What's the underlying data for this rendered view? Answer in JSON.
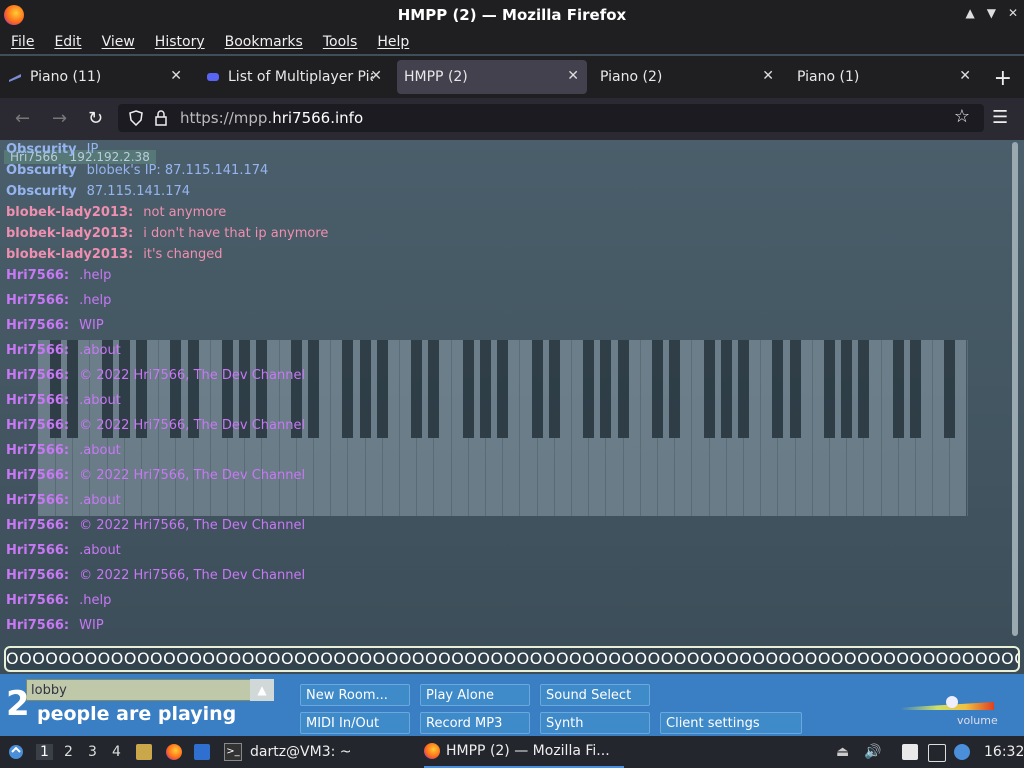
{
  "window": {
    "title": "HMPP (2) — Mozilla Firefox",
    "controls": [
      "▲",
      "▼",
      "✕"
    ]
  },
  "menu": [
    "File",
    "Edit",
    "View",
    "History",
    "Bookmarks",
    "Tools",
    "Help"
  ],
  "tabs": [
    {
      "label": "Piano (11)",
      "active": false
    },
    {
      "label": "List of Multiplayer Pia",
      "active": false
    },
    {
      "label": "HMPP (2)",
      "active": true
    },
    {
      "label": "Piano (2)",
      "active": false
    },
    {
      "label": "Piano (1)",
      "active": false
    }
  ],
  "nav": {
    "url_prefix": "https://mpp.",
    "url_domain": "hri7566.info"
  },
  "overlay_ids": [
    "Hri7566",
    "192.192.2.38"
  ],
  "chat": [
    {
      "name": "Obscurity",
      "text": "IP",
      "color": "blue"
    },
    {
      "name": "Obscurity",
      "text": "blobek's IP: 87.115.141.174",
      "color": "blue"
    },
    {
      "name": "Obscurity",
      "text": "87.115.141.174",
      "color": "blue"
    },
    {
      "name": "blobek-lady2013:",
      "text": "not anymore",
      "color": "pink"
    },
    {
      "name": "blobek-lady2013:",
      "text": "i don't have that ip anymore",
      "color": "pink"
    },
    {
      "name": "blobek-lady2013:",
      "text": "it's changed",
      "color": "pink"
    },
    {
      "name": "Hri7566:",
      "text": ".help",
      "color": "purple"
    },
    {
      "name": "Hri7566:",
      "text": ".help",
      "color": "purple"
    },
    {
      "name": "Hri7566:",
      "text": "WIP",
      "color": "purple"
    },
    {
      "name": "Hri7566:",
      "text": ".about",
      "color": "purple"
    },
    {
      "name": "Hri7566:",
      "text": "© 2022 Hri7566, The Dev Channel",
      "color": "purple"
    },
    {
      "name": "Hri7566:",
      "text": ".about",
      "color": "purple"
    },
    {
      "name": "Hri7566:",
      "text": "© 2022 Hri7566, The Dev Channel",
      "color": "purple"
    },
    {
      "name": "Hri7566:",
      "text": ".about",
      "color": "purple"
    },
    {
      "name": "Hri7566:",
      "text": "© 2022 Hri7566, The Dev Channel",
      "color": "purple"
    },
    {
      "name": "Hri7566:",
      "text": ".about",
      "color": "purple"
    },
    {
      "name": "Hri7566:",
      "text": "© 2022 Hri7566, The Dev Channel",
      "color": "purple"
    },
    {
      "name": "Hri7566:",
      "text": ".about",
      "color": "purple"
    },
    {
      "name": "Hri7566:",
      "text": "© 2022 Hri7566, The Dev Channel",
      "color": "purple"
    },
    {
      "name": "Hri7566:",
      "text": ".help",
      "color": "purple"
    },
    {
      "name": "Hri7566:",
      "text": "WIP",
      "color": "purple"
    }
  ],
  "chat_input": "OOOOOOOOOOOOOOOOOOOOOOOOOOOOOOOOOOOOOOOOOOOOOOOOOOOOOOOOOOOOOOOOOOOOOOOOOOOOOOOOOOOOOOOOO",
  "room": {
    "value": "lobby",
    "count": "2",
    "count_label": "people are playing"
  },
  "buttons": [
    "New Room...",
    "Play Alone",
    "Sound Select",
    "MIDI In/Out",
    "Record MP3",
    "Synth",
    "Client settings"
  ],
  "volume_label": "volume",
  "taskbar": {
    "workspaces": [
      "1",
      "2",
      "3",
      "4"
    ],
    "terminal": "dartz@VM3: ~",
    "firefox_task": "HMPP (2) — Mozilla Fi...",
    "clock": "16:32"
  },
  "colors": {
    "pink": "#f08fb0",
    "purple": "#c878f5",
    "blue": "#96b4f0",
    "bottom_bar": "#3a7ec3"
  }
}
